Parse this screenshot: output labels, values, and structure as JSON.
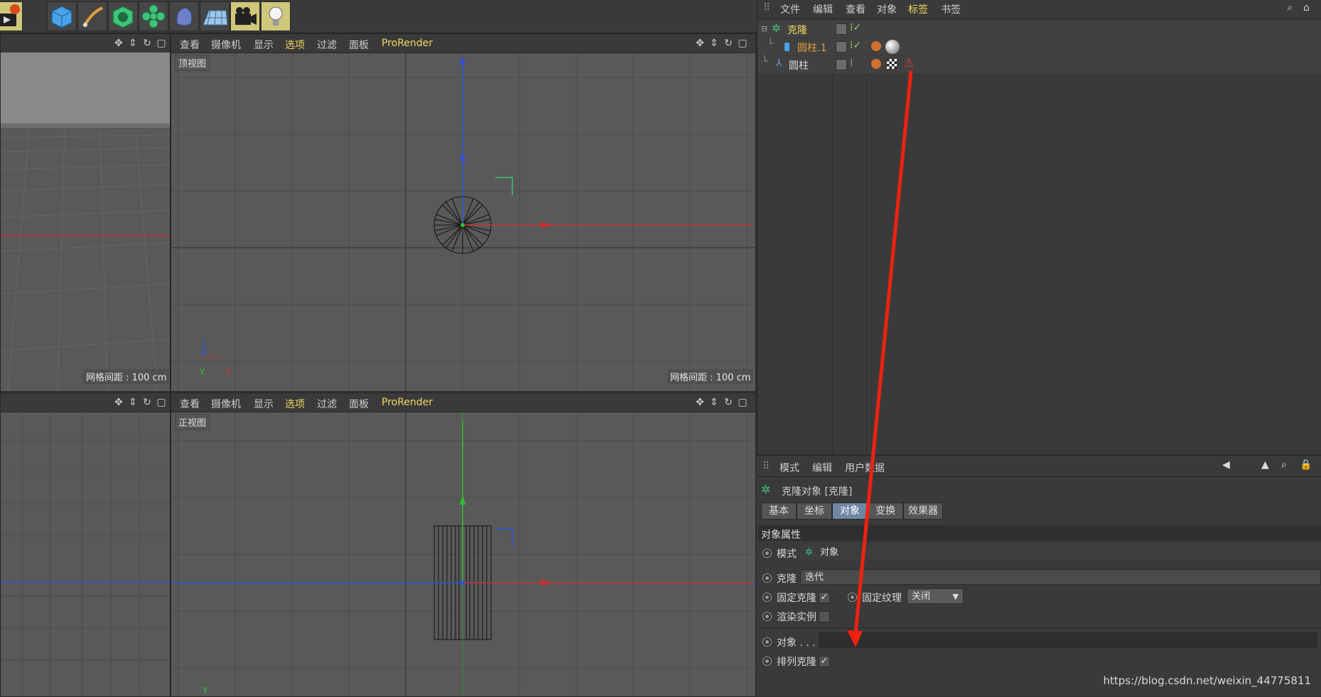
{
  "toolbar": {
    "icons": [
      "render-icon",
      "cube-icon",
      "pen-icon",
      "subdivision-icon",
      "cloner-icon",
      "deformer-icon",
      "floor-icon",
      "camera-icon",
      "light-icon"
    ]
  },
  "viewport_menu": [
    "查看",
    "摄像机",
    "显示",
    "选项",
    "过滤",
    "面板",
    "ProRender"
  ],
  "viewport_top": {
    "label": "顶视图",
    "grid_info": "网格间距 : 100 cm",
    "axis_y": "Z",
    "axis_x": "X",
    "axis_origin": "Y"
  },
  "viewport_front": {
    "label": "正视图",
    "axis_y": "Y"
  },
  "viewport_persp": {
    "grid_info": "网格间距 : 100 cm"
  },
  "object_manager": {
    "menu": [
      "文件",
      "编辑",
      "查看",
      "对象",
      "标签",
      "书签"
    ],
    "objects": [
      {
        "name": "克隆",
        "color": "#f0d860"
      },
      {
        "name": "圆柱.1",
        "color": "#e0a040"
      },
      {
        "name": "圆柱",
        "color": "#d8d8d8"
      }
    ]
  },
  "attribute_manager": {
    "menu": [
      "模式",
      "编辑",
      "用户数据"
    ],
    "title": "克隆对象 [克隆]",
    "tabs": [
      "基本",
      "坐标",
      "对象",
      "变换",
      "效果器"
    ],
    "selected_tab": "对象",
    "section": "对象属性",
    "props": {
      "mode_label": "模式",
      "mode_value": "对象",
      "clone_label": "克隆",
      "clone_value": "迭代",
      "fixed_clone_label": "固定克隆",
      "fixed_clone_check": "✓",
      "fixed_texture_label": "固定纹理",
      "fixed_texture_value": "关闭",
      "render_instance_label": "渲染实例",
      "object_label": "对象 . . .",
      "arrange_clone_label": "排列克隆",
      "arrange_clone_check": "✓"
    }
  },
  "watermark": "https://blog.csdn.net/weixin_44775811",
  "colors": {
    "annotation": "#ee2211",
    "axis_x": "#d03030",
    "axis_y": "#30c030",
    "axis_z": "#3050e0"
  }
}
